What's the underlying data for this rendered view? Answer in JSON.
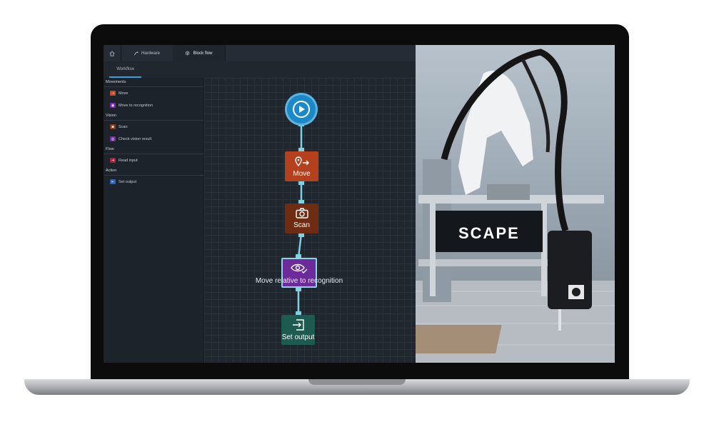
{
  "tabs": [
    {
      "icon": "home-icon",
      "label": ""
    },
    {
      "icon": "robot-arm-icon",
      "label": "Hardware"
    },
    {
      "icon": "gear-icon",
      "label": "Block flow"
    }
  ],
  "subtabs": {
    "workflow": "Workflow"
  },
  "sidebar": {
    "categories": [
      {
        "title": "Movements",
        "items": [
          {
            "label": "Move",
            "color": "#c64b24"
          },
          {
            "label": "Move to recognition",
            "color": "#7a2aa8"
          }
        ]
      },
      {
        "title": "Vision",
        "items": [
          {
            "label": "Scan",
            "color": "#8a3a1c"
          },
          {
            "label": "Check vision result",
            "color": "#7a2aa8"
          }
        ]
      },
      {
        "title": "Flow",
        "items": [
          {
            "label": "Read input",
            "color": "#b0203c"
          }
        ]
      },
      {
        "title": "Action",
        "items": [
          {
            "label": "Set output",
            "color": "#2a5fc9"
          }
        ]
      }
    ]
  },
  "flow": {
    "nodes": [
      {
        "label": "Move",
        "color": "#b5401e",
        "icon": "pin-arrow-icon"
      },
      {
        "label": "Scan",
        "color": "#6e2c12",
        "icon": "camera-icon"
      },
      {
        "label": "Move relative to recognition",
        "color": "#6d2a9a",
        "icon": "eye-check-icon"
      },
      {
        "label": "Set output",
        "color": "#1d5a50",
        "icon": "output-icon"
      }
    ]
  },
  "photo": {
    "logo": "SCAPE"
  }
}
